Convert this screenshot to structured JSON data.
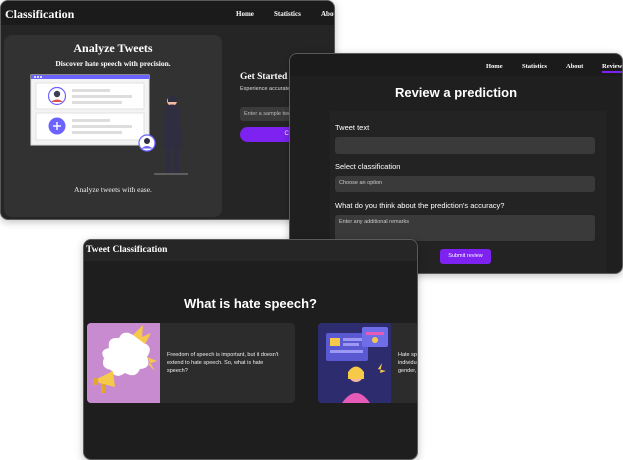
{
  "win1": {
    "brand": "Classification",
    "nav": [
      "Home",
      "Statistics",
      "Abou"
    ],
    "hero": {
      "title": "Analyze Tweets",
      "subtitle": "Discover hate speech with precision.",
      "caption": "Analyze tweets with ease."
    },
    "panel": {
      "heading": "Get Started Now",
      "description": "Experience accurate hate speech de",
      "input_placeholder": "Enter a sample tweet",
      "button": "Classify"
    }
  },
  "win2": {
    "nav": [
      "Home",
      "Statistics",
      "About",
      "Review"
    ],
    "title": "Review a prediction",
    "tweet_label": "Tweet text",
    "class_label": "Select classification",
    "class_value": "Choose an option",
    "remarks_label": "What do you think about the prediction's accuracy?",
    "remarks_placeholder": "Enter any additional remarks",
    "submit": "Submit review"
  },
  "win3": {
    "brand": "Tweet Classification",
    "title": "What is hate speech?",
    "cards": [
      {
        "text": "Freedom of speech is important, but it doesn't extend to hate speech. So, what is hate speech?"
      },
      {
        "text": "Hate sp\nindividu\ngender,"
      }
    ]
  },
  "colors": {
    "accent": "#7d22f0",
    "bg": "#1f1f1f",
    "avatar": "#6c63ff"
  },
  "icons": [
    "person-avatar-icon",
    "plus-icon",
    "megaphone-icon",
    "speech-cloud-icon"
  ]
}
